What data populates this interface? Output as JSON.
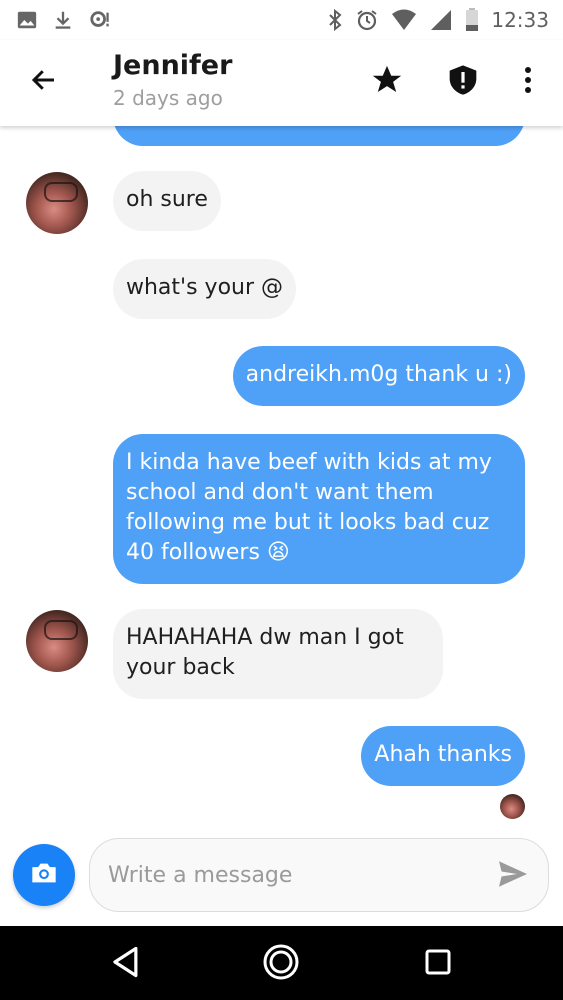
{
  "status_bar": {
    "time": "12:33",
    "left_icons": [
      "image-icon",
      "download-icon",
      "notification-icon"
    ],
    "right_icons": [
      "bluetooth-icon",
      "alarm-icon",
      "wifi-icon",
      "signal-icon",
      "battery-icon"
    ]
  },
  "header": {
    "name": "Jennifer",
    "last_seen": "2 days ago",
    "icons": [
      "back-arrow-icon",
      "star-icon",
      "shield-alert-icon",
      "more-vert-icon"
    ]
  },
  "messages": [
    {
      "direction": "in",
      "text": "oh sure",
      "avatar": true
    },
    {
      "direction": "in",
      "text": "what's your @",
      "avatar": false
    },
    {
      "direction": "out",
      "text": "andreikh.m0g thank u :)"
    },
    {
      "direction": "out",
      "text": "I kinda have beef with kids at my school and don't want them following me but it looks bad cuz 40 followers 😫"
    },
    {
      "direction": "in",
      "text": "HAHAHAHA dw man I got your back",
      "avatar": true
    },
    {
      "direction": "out",
      "text": "Ahah thanks"
    }
  ],
  "composer": {
    "placeholder": "Write a message",
    "value": "",
    "icons": [
      "camera-icon",
      "send-icon"
    ]
  },
  "colors": {
    "outgoing_bubble": "#4fa0f7",
    "incoming_bubble": "#f3f3f3",
    "camera_button": "#1a82f7"
  }
}
